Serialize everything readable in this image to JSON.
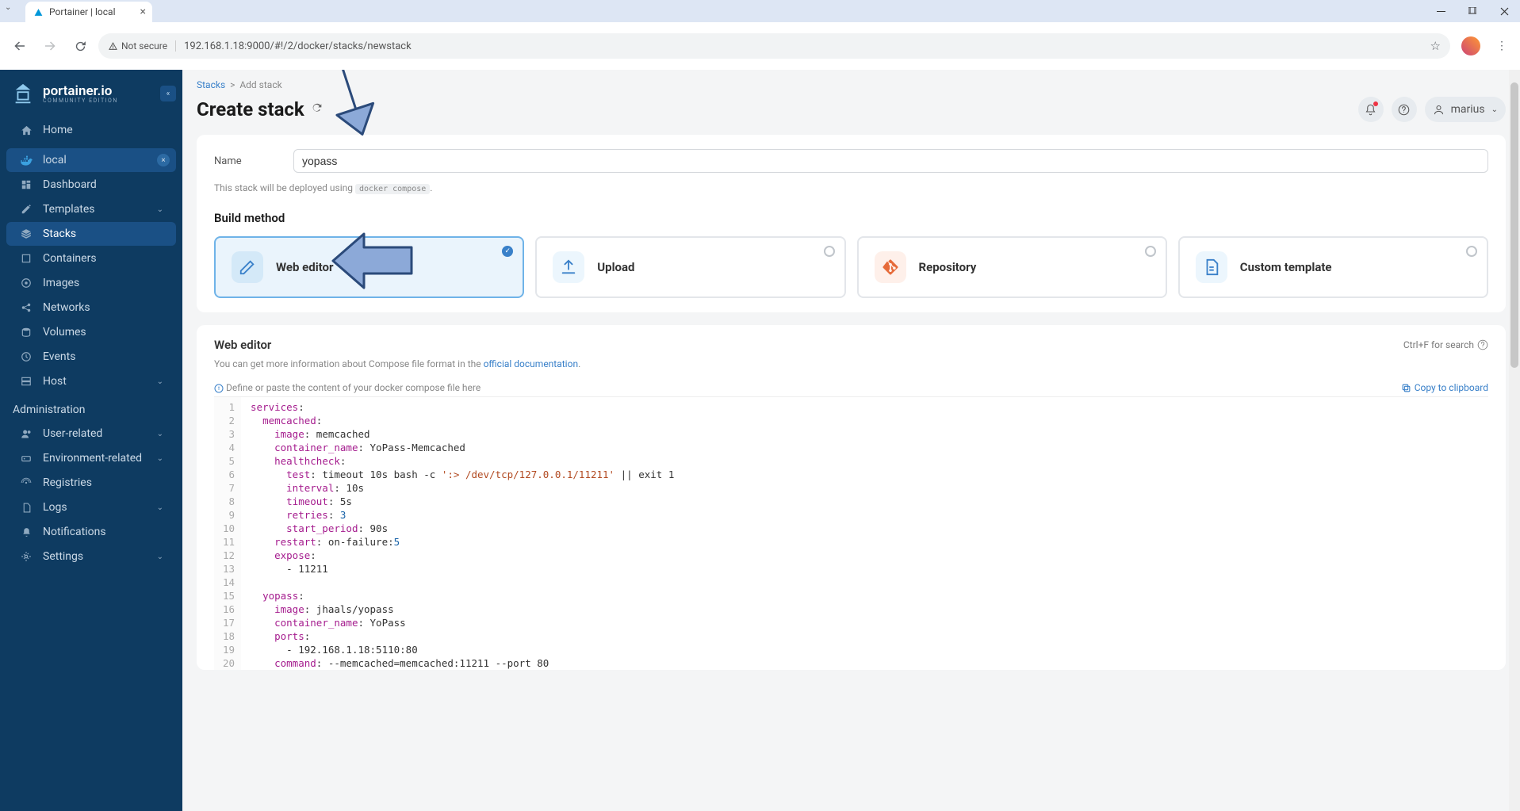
{
  "browser": {
    "tab_title": "Portainer | local",
    "url": "192.168.1.18:9000/#!/2/docker/stacks/newstack",
    "not_secure": "Not secure"
  },
  "sidebar": {
    "logo_name": "portainer.io",
    "logo_sub": "COMMUNITY EDITION",
    "home": "Home",
    "env_name": "local",
    "items": {
      "dashboard": "Dashboard",
      "templates": "Templates",
      "stacks": "Stacks",
      "containers": "Containers",
      "images": "Images",
      "networks": "Networks",
      "volumes": "Volumes",
      "events": "Events",
      "host": "Host"
    },
    "admin_heading": "Administration",
    "admin": {
      "user": "User-related",
      "env": "Environment-related",
      "registries": "Registries",
      "logs": "Logs",
      "notifications": "Notifications",
      "settings": "Settings"
    }
  },
  "breadcrumb": {
    "stacks": "Stacks",
    "add": "Add stack"
  },
  "page": {
    "title": "Create stack",
    "username": "marius"
  },
  "form": {
    "name_label": "Name",
    "name_value": "yopass",
    "hint_pre": "This stack will be deployed using ",
    "hint_code": "docker compose",
    "build_method": "Build method",
    "methods": {
      "web": "Web editor",
      "upload": "Upload",
      "repo": "Repository",
      "custom": "Custom template"
    }
  },
  "editor": {
    "title": "Web editor",
    "search_hint": "Ctrl+F for search",
    "desc_pre": "You can get more information about Compose file format in the ",
    "desc_link": "official documentation",
    "placeholder": "Define or paste the content of your docker compose file here",
    "copy": "Copy to clipboard",
    "lines": [
      "1",
      "2",
      "3",
      "4",
      "5",
      "6",
      "7",
      "8",
      "9",
      "10",
      "11",
      "12",
      "13",
      "14",
      "15",
      "16",
      "17",
      "18",
      "19",
      "20"
    ],
    "code": {
      "l1_k": "services",
      "l1_c": ":",
      "l2_k": "memcached",
      "l2_c": ":",
      "l3_k": "image",
      "l3_c": ": memcached",
      "l4_k": "container_name",
      "l4_c": ": YoPass-Memcached",
      "l5_k": "healthcheck",
      "l5_c": ":",
      "l6_k": "test",
      "l6_mid": ": timeout 10s bash -c ",
      "l6_str": "':> /dev/tcp/127.0.0.1/11211'",
      "l6_end": " || exit 1",
      "l7_k": "interval",
      "l7_c": ": 10s",
      "l8_k": "timeout",
      "l8_c": ": 5s",
      "l9_k": "retries",
      "l9_c": ": ",
      "l9_n": "3",
      "l10_k": "start_period",
      "l10_c": ": 90s",
      "l11_k": "restart",
      "l11_mid": ": on-failure:",
      "l11_n": "5",
      "l12_k": "expose",
      "l12_c": ":",
      "l13_c": "- 11211",
      "l15_k": "yopass",
      "l15_c": ":",
      "l16_k": "image",
      "l16_c": ": jhaals/yopass",
      "l17_k": "container_name",
      "l17_c": ": YoPass",
      "l18_k": "ports",
      "l18_c": ":",
      "l19_c": "- 192.168.1.18:5110:80",
      "l20_k": "command",
      "l20_c": ": --memcached=memcached:11211 --port 80"
    }
  }
}
